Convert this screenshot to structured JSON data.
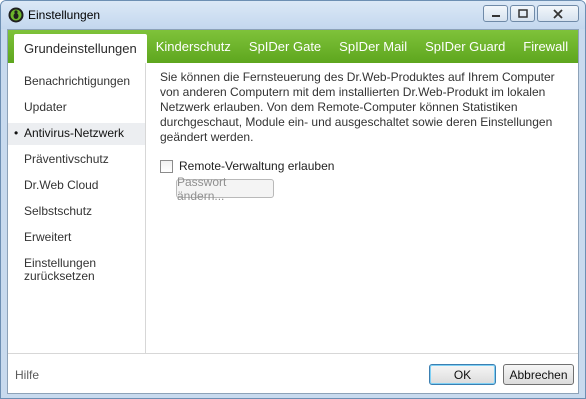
{
  "window": {
    "title": "Einstellungen",
    "app_icon": "drweb-spider-icon"
  },
  "tabs": [
    {
      "label": "Grundeinstellungen",
      "active": true
    },
    {
      "label": "Kinderschutz",
      "active": false
    },
    {
      "label": "SpIDer Gate",
      "active": false
    },
    {
      "label": "SpIDer Mail",
      "active": false
    },
    {
      "label": "SpIDer Guard",
      "active": false
    },
    {
      "label": "Firewall",
      "active": false
    }
  ],
  "sidebar": {
    "items": [
      {
        "label": "Benachrichtigungen"
      },
      {
        "label": "Updater"
      },
      {
        "label": "Antivirus-Netzwerk",
        "selected": true,
        "bullet": "•"
      },
      {
        "label": "Präventivschutz"
      },
      {
        "label": "Dr.Web Cloud"
      },
      {
        "label": "Selbstschutz"
      },
      {
        "label": "Erweitert"
      },
      {
        "label": "Einstellungen zurücksetzen"
      }
    ]
  },
  "content": {
    "description": "Sie können die Fernsteuerung des Dr.Web-Produktes auf Ihrem Computer von anderen Computern mit dem installierten Dr.Web-Produkt im lokalen Netzwerk erlauben. Von dem Remote-Computer können Statistiken durchgeschaut, Module ein- und ausgeschaltet sowie deren Einstellungen geändert werden.",
    "remote_checkbox_label": "Remote-Verwaltung erlauben",
    "remote_checked": false,
    "password_button": "Passwort ändern..."
  },
  "footer": {
    "help": "Hilfe",
    "ok": "OK",
    "cancel": "Abbrechen"
  },
  "colors": {
    "tabbar_green": "#6cb52b",
    "title_bg": "#c8daee"
  }
}
